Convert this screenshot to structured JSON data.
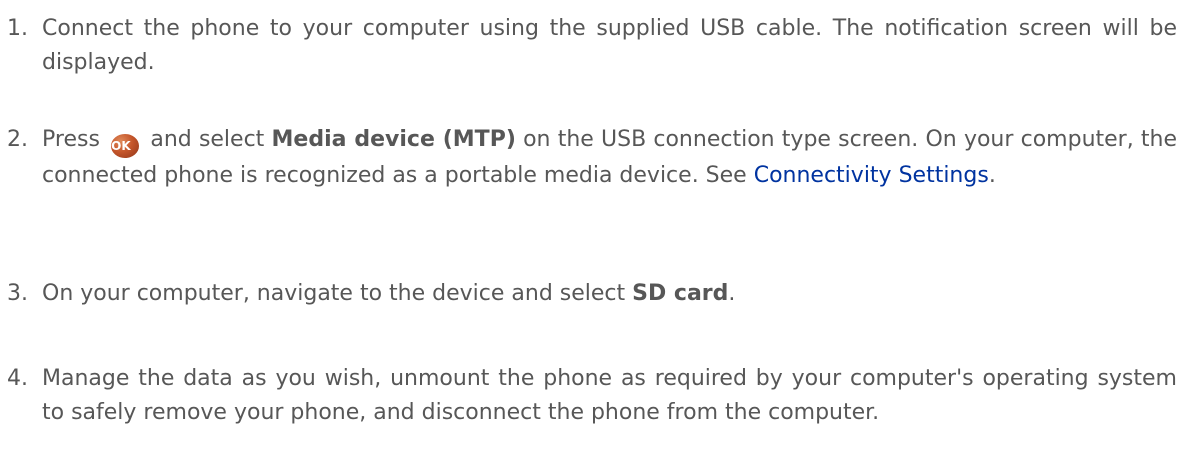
{
  "steps": [
    {
      "number": "1.",
      "text": "Connect the phone to your computer using the supplied USB cable. The notification screen will be displayed."
    },
    {
      "number": "2.",
      "prefix": "Press",
      "ok_label": "OK",
      "mid": "and select",
      "bold": "Media device (MTP)",
      "rest": "on the USB connection type screen. On your computer, the connected phone is recognized as a portable media device. See",
      "link": "Connectivity Settings",
      "end": "."
    },
    {
      "number": "3.",
      "prefix": "On your computer, navigate to the device and select",
      "bold": "SD card",
      "end": "."
    },
    {
      "number": "4.",
      "text": "Manage the data as you wish, unmount the phone as required by your computer's operating system to safely remove your phone, and disconnect the phone from the computer."
    }
  ],
  "colors": {
    "text": "#575757",
    "link": "#0033a0",
    "ok_button": "#c5562b"
  }
}
